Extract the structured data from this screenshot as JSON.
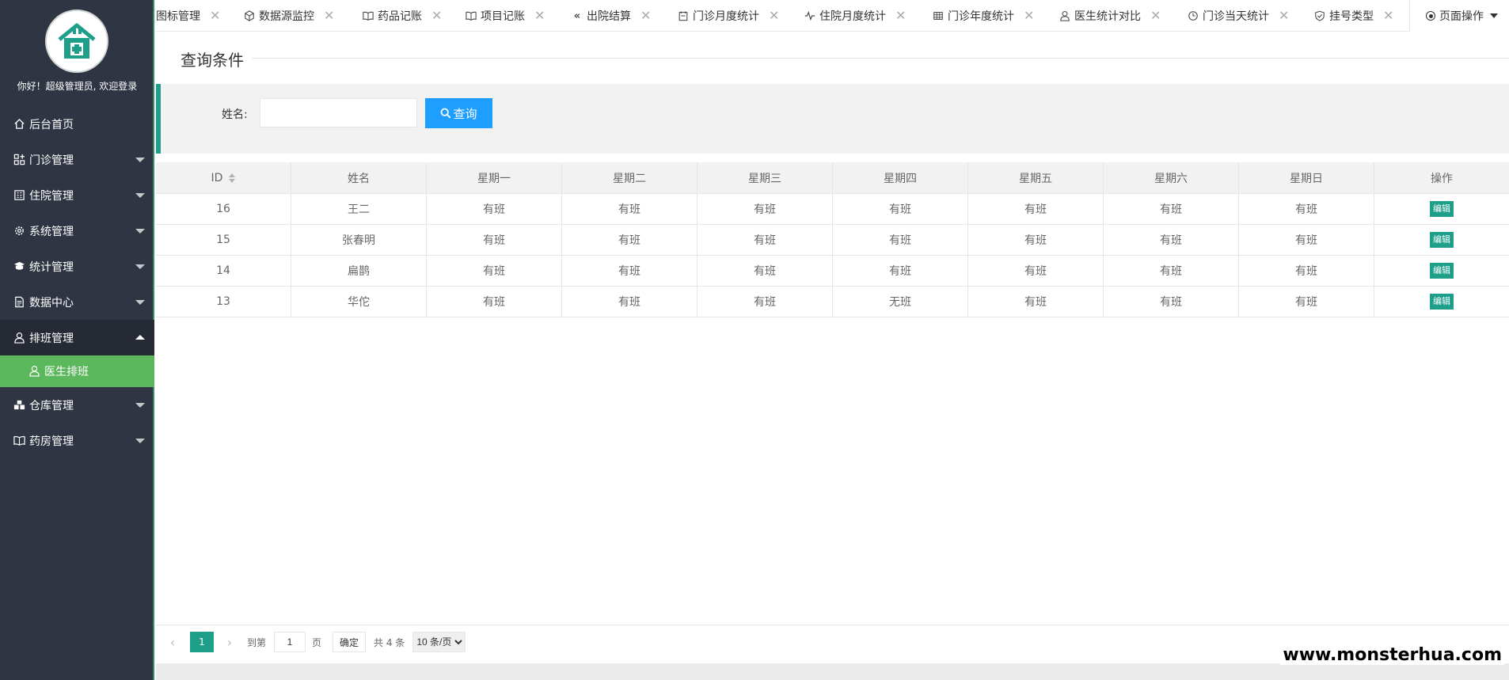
{
  "sidebar": {
    "welcome": "你好！超级管理员, 欢迎登录",
    "items": [
      {
        "label": "后台首页",
        "icon": "home-icon"
      },
      {
        "label": "门诊管理",
        "icon": "grid-plus-icon"
      },
      {
        "label": "住院管理",
        "icon": "building-icon"
      },
      {
        "label": "系统管理",
        "icon": "gear-icon"
      },
      {
        "label": "统计管理",
        "icon": "chart-icon"
      },
      {
        "label": "数据中心",
        "icon": "document-icon"
      },
      {
        "label": "排班管理",
        "icon": "user-icon"
      },
      {
        "label": "仓库管理",
        "icon": "warehouse-icon"
      },
      {
        "label": "药房管理",
        "icon": "book-icon"
      }
    ],
    "sub_item": {
      "label": "医生排班",
      "icon": "user-icon"
    }
  },
  "tabs": [
    {
      "label": "图标管理",
      "icon": ""
    },
    {
      "label": "数据源监控",
      "icon": "cube-icon"
    },
    {
      "label": "药品记账",
      "icon": "book-icon"
    },
    {
      "label": "项目记账",
      "icon": "book-icon"
    },
    {
      "label": "出院结算",
      "icon": "double-left-icon"
    },
    {
      "label": "门诊月度统计",
      "icon": "calendar-icon"
    },
    {
      "label": "住院月度统计",
      "icon": "pulse-icon"
    },
    {
      "label": "门诊年度统计",
      "icon": "table-icon"
    },
    {
      "label": "医生统计对比",
      "icon": "user-icon"
    },
    {
      "label": "门诊当天统计",
      "icon": "clock-icon"
    },
    {
      "label": "挂号类型",
      "icon": "shield-icon"
    }
  ],
  "page_ops": "页面操作",
  "query": {
    "legend": "查询条件",
    "name_label": "姓名:",
    "name_value": "",
    "button": "查询"
  },
  "table": {
    "headers": [
      "ID",
      "姓名",
      "星期一",
      "星期二",
      "星期三",
      "星期四",
      "星期五",
      "星期六",
      "星期日",
      "操作"
    ],
    "rows": [
      {
        "id": "16",
        "name": "王二",
        "days": [
          "有班",
          "有班",
          "有班",
          "有班",
          "有班",
          "有班",
          "有班"
        ],
        "action": "编辑"
      },
      {
        "id": "15",
        "name": "张春明",
        "days": [
          "有班",
          "有班",
          "有班",
          "有班",
          "有班",
          "有班",
          "有班"
        ],
        "action": "编辑"
      },
      {
        "id": "14",
        "name": "扁鹊",
        "days": [
          "有班",
          "有班",
          "有班",
          "有班",
          "有班",
          "有班",
          "有班"
        ],
        "action": "编辑"
      },
      {
        "id": "13",
        "name": "华佗",
        "days": [
          "有班",
          "有班",
          "有班",
          "无班",
          "有班",
          "有班",
          "有班"
        ],
        "action": "编辑"
      }
    ]
  },
  "pager": {
    "current": "1",
    "goto_label": "到第",
    "goto_value": "1",
    "page_unit": "页",
    "confirm": "确定",
    "total": "共 4 条",
    "page_size": "10 条/页"
  },
  "watermark": "www.monsterhua.com",
  "colors": {
    "sidebar_bg": "#2f3542",
    "accent": "#1e9f8a",
    "query_btn": "#1e9fff",
    "sub_active": "#5cb85c"
  }
}
